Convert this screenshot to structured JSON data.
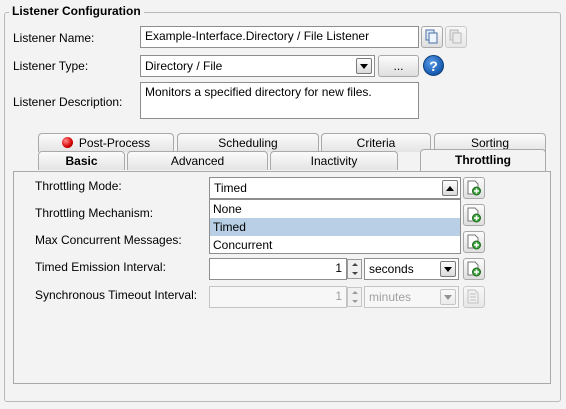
{
  "group": {
    "title": "Listener Configuration"
  },
  "listener_name": {
    "label": "Listener Name:",
    "value": "Example-Interface.Directory / File Listener"
  },
  "listener_type": {
    "label": "Listener Type:",
    "value": "Directory / File",
    "browse_label": "..."
  },
  "listener_description": {
    "label": "Listener Description:",
    "value": "Monitors a specified directory for new files."
  },
  "tabs_top": [
    {
      "label": "Post-Process",
      "has_error_icon": true
    },
    {
      "label": "Scheduling"
    },
    {
      "label": "Criteria"
    },
    {
      "label": "Sorting"
    }
  ],
  "tabs_bottom": [
    {
      "label": "Basic"
    },
    {
      "label": "Advanced"
    },
    {
      "label": "Inactivity"
    },
    {
      "label": "Throttling",
      "selected": true
    }
  ],
  "throttling": {
    "mode_label": "Throttling Mode:",
    "mode_value": "Timed",
    "mechanism_label": "Throttling Mechanism:",
    "max_concurrent_label": "Max Concurrent Messages:",
    "timed_interval_label": "Timed Emission Interval:",
    "timed_interval_value": "1",
    "timed_interval_unit": "seconds",
    "sync_timeout_label": "Synchronous Timeout Interval:",
    "sync_timeout_value": "1",
    "sync_timeout_unit": "minutes",
    "dropdown_options": [
      "None",
      "Timed",
      "Concurrent"
    ],
    "dropdown_selected": "Timed"
  },
  "colors": {
    "help_blue": "#1a5fb4",
    "selection": "#b8cfe5",
    "error_red": "#d40000"
  },
  "icons": [
    "copy-icon",
    "paste-icon",
    "help-icon",
    "add-variable-icon",
    "error-dot-icon"
  ]
}
